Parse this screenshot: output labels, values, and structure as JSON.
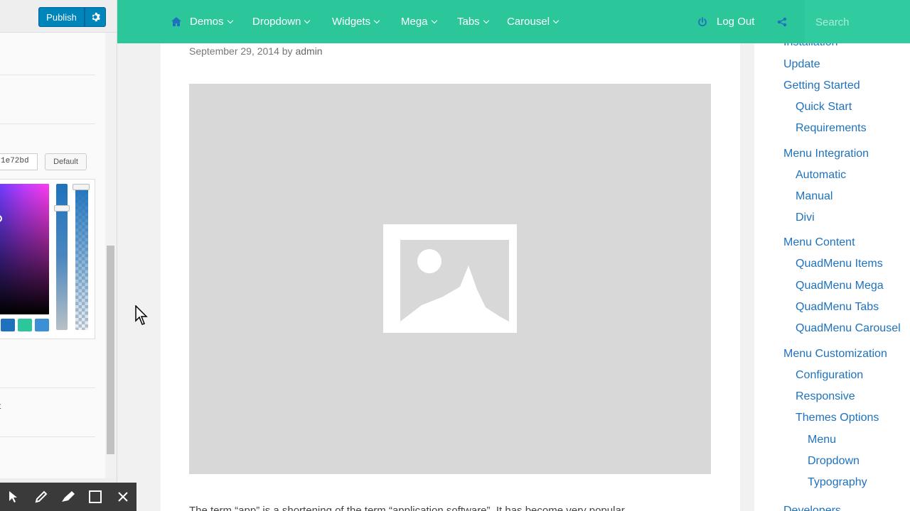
{
  "customizer": {
    "publish_label": "Publish",
    "color_value": "1e72bd",
    "default_label": "Default",
    "cut_text": "t",
    "swatches": [
      "#1e72bd",
      "#2bc69a",
      "#3d8fd6"
    ]
  },
  "annotation_toolbar": {
    "tools": [
      "pointer",
      "pen",
      "highlighter",
      "rectangle",
      "close"
    ]
  },
  "nav": {
    "items": [
      {
        "label": "Demos",
        "icon": "home-icon"
      },
      {
        "label": "Dropdown"
      },
      {
        "label": "Widgets"
      },
      {
        "label": "Mega"
      },
      {
        "label": "Tabs"
      },
      {
        "label": "Carousel"
      }
    ],
    "logout_label": "Log Out",
    "search_placeholder": "Search",
    "accent_color": "#2bc69a"
  },
  "post": {
    "date": "September 29, 2014",
    "by": "by",
    "author": "admin",
    "text_partial": "The term “app” is a shortening of the term “application software”. It has become very popular"
  },
  "toc": {
    "link_color": "#1e72bd",
    "items": [
      {
        "label": "Installation",
        "level": 1
      },
      {
        "label": "Update",
        "level": 1
      },
      {
        "label": "Getting Started",
        "level": 1
      },
      {
        "label": "Quick Start",
        "level": 2
      },
      {
        "label": "Requirements",
        "level": 2
      },
      {
        "label": "Menu Integration",
        "level": 1
      },
      {
        "label": "Automatic",
        "level": 2
      },
      {
        "label": "Manual",
        "level": 2
      },
      {
        "label": "Divi",
        "level": 2
      },
      {
        "label": "Menu Content",
        "level": 1
      },
      {
        "label": "QuadMenu Items",
        "level": 2
      },
      {
        "label": "QuadMenu Mega",
        "level": 2
      },
      {
        "label": "QuadMenu Tabs",
        "level": 2
      },
      {
        "label": "QuadMenu Carousel",
        "level": 2
      },
      {
        "label": "Menu Customization",
        "level": 1
      },
      {
        "label": "Configuration",
        "level": 2
      },
      {
        "label": "Responsive",
        "level": 2
      },
      {
        "label": "Themes Options",
        "level": 2
      },
      {
        "label": "Menu",
        "level": 3
      },
      {
        "label": "Dropdown",
        "level": 3
      },
      {
        "label": "Typography",
        "level": 3
      },
      {
        "label": "Developers",
        "level": 1
      }
    ]
  }
}
